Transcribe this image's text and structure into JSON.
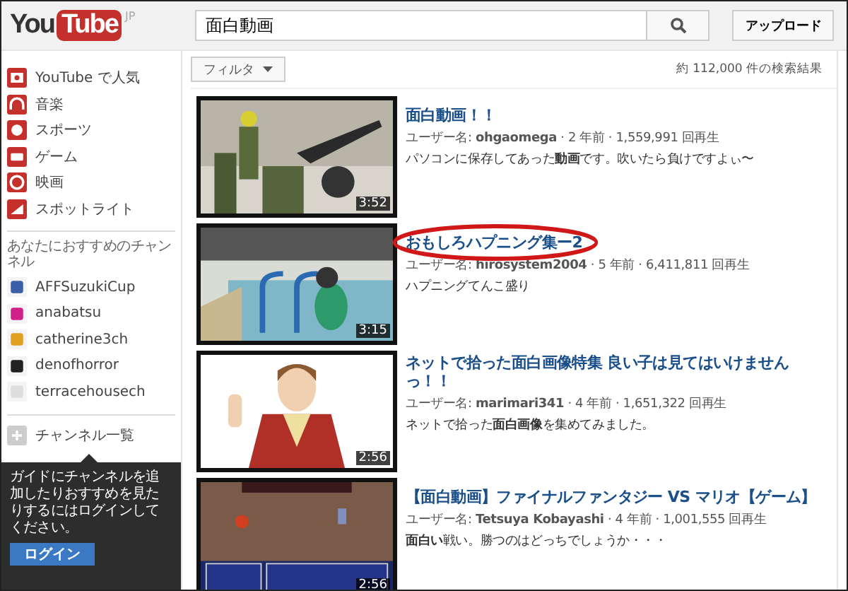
{
  "header": {
    "logo_you": "You",
    "logo_tube": "Tube",
    "region": "JP",
    "search_value": "面白動画",
    "upload": "アップロード"
  },
  "sidebar": {
    "items": [
      {
        "label": "YouTube で人気",
        "kind": "popular"
      },
      {
        "label": "音楽",
        "kind": "music"
      },
      {
        "label": "スポーツ",
        "kind": "sports"
      },
      {
        "label": "ゲーム",
        "kind": "games"
      },
      {
        "label": "映画",
        "kind": "movies"
      },
      {
        "label": "スポットライト",
        "kind": "spotlight"
      }
    ],
    "channels_heading": "あなたにおすすめのチャンネル",
    "channels": [
      {
        "name": "AFFSuzukiCup",
        "color": "#3a5fa8"
      },
      {
        "name": "anabatsu",
        "color": "#d0208a"
      },
      {
        "name": "catherine3ch",
        "color": "#e0a020"
      },
      {
        "name": "denofhorror",
        "color": "#222222"
      },
      {
        "name": "terracehousech",
        "color": "#dddddd"
      }
    ],
    "channel_list": "チャンネル一覧",
    "tooltip": {
      "text": "ガイドにチャンネルを追加したりおすすめを見たりするにはログインしてください。",
      "button": "ログイン"
    }
  },
  "filter": "フィルタ",
  "result_count": "約 112,000 件の検索結果",
  "results": [
    {
      "title": "面白動画！！",
      "meta": "ユーザー名: **ohgaomega** · 2 年前 · 1,559,991 回再生",
      "description": "パソコンに保存してあった**動画**です。吹いたら負けですよぃ〜",
      "duration": "3:52",
      "highlighted": false,
      "kind": "soldiers"
    },
    {
      "title": "おもしろハプニング集ー2",
      "meta": "ユーザー名: **hirosystem2004** · 5 年前 · 6,411,811 回再生",
      "description": "ハプニングてんこ盛り",
      "duration": "3:15",
      "highlighted": true,
      "kind": "pool"
    },
    {
      "title": "ネットで拾った面白画像特集 良い子は見てはいけませんっ！！",
      "meta": "ユーザー名: **marimari341** · 4 年前 · 1,651,322 回再生",
      "description": "ネットで拾った**面白画像**を集めてみました。",
      "duration": "2:56",
      "highlighted": false,
      "kind": "cartoon"
    },
    {
      "title": "【面白動画】ファイナルファンタジー VS マリオ【ゲーム】",
      "meta": "ユーザー名: **Tetsuya Kobayashi** · 4 年前 · 1,001,555 回再生",
      "description": "**面白い**戦い。勝つのはどっちでしょうか・・・",
      "duration": "2:56",
      "highlighted": false,
      "kind": "game"
    }
  ]
}
